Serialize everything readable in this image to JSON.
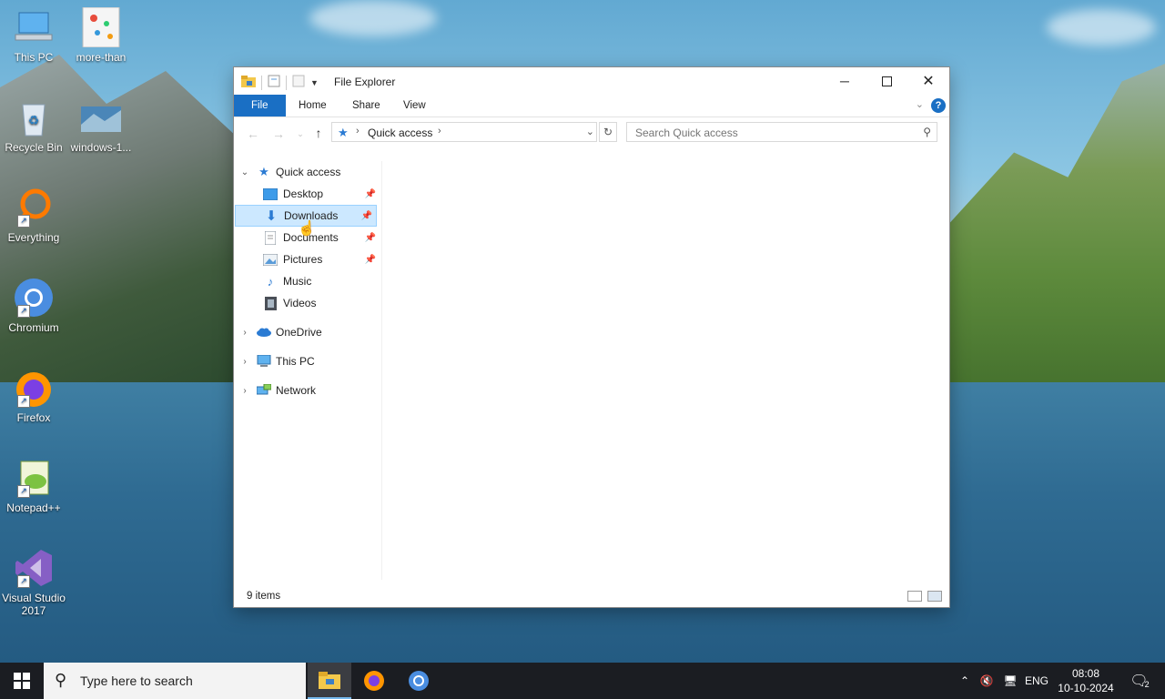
{
  "desktop": {
    "icons": [
      {
        "label": "This PC"
      },
      {
        "label": "more-than"
      },
      {
        "label": "Recycle Bin"
      },
      {
        "label": "windows-1..."
      },
      {
        "label": "Everything"
      },
      {
        "label": "Chromium"
      },
      {
        "label": "Firefox"
      },
      {
        "label": "Notepad++"
      },
      {
        "label": "Visual Studio 2017"
      }
    ]
  },
  "window": {
    "title": "File Explorer",
    "ribbon_tabs": [
      "File",
      "Home",
      "Share",
      "View"
    ],
    "help_label": "?",
    "address": {
      "location": "Quick access"
    },
    "search": {
      "placeholder": "Search Quick access"
    },
    "nav_tree": [
      {
        "label": "Quick access",
        "level": 0,
        "expanded": true
      },
      {
        "label": "Desktop",
        "level": 1,
        "pinned": true
      },
      {
        "label": "Downloads",
        "level": 1,
        "pinned": true,
        "selected": true
      },
      {
        "label": "Documents",
        "level": 1,
        "pinned": true
      },
      {
        "label": "Pictures",
        "level": 1,
        "pinned": true
      },
      {
        "label": "Music",
        "level": 1
      },
      {
        "label": "Videos",
        "level": 1
      },
      {
        "label": "OneDrive",
        "level": 0,
        "expanded": false
      },
      {
        "label": "This PC",
        "level": 0,
        "expanded": false
      },
      {
        "label": "Network",
        "level": 0,
        "expanded": false
      }
    ],
    "status": {
      "item_count": "9 items"
    }
  },
  "taskbar": {
    "search_placeholder": "Type here to search",
    "language": "ENG",
    "time": "08:08",
    "date": "10-10-2024",
    "notification_count": "2"
  },
  "colors": {
    "accent": "#1a6fc4",
    "selection": "#cce8ff",
    "taskbar": "#1b1d22"
  }
}
